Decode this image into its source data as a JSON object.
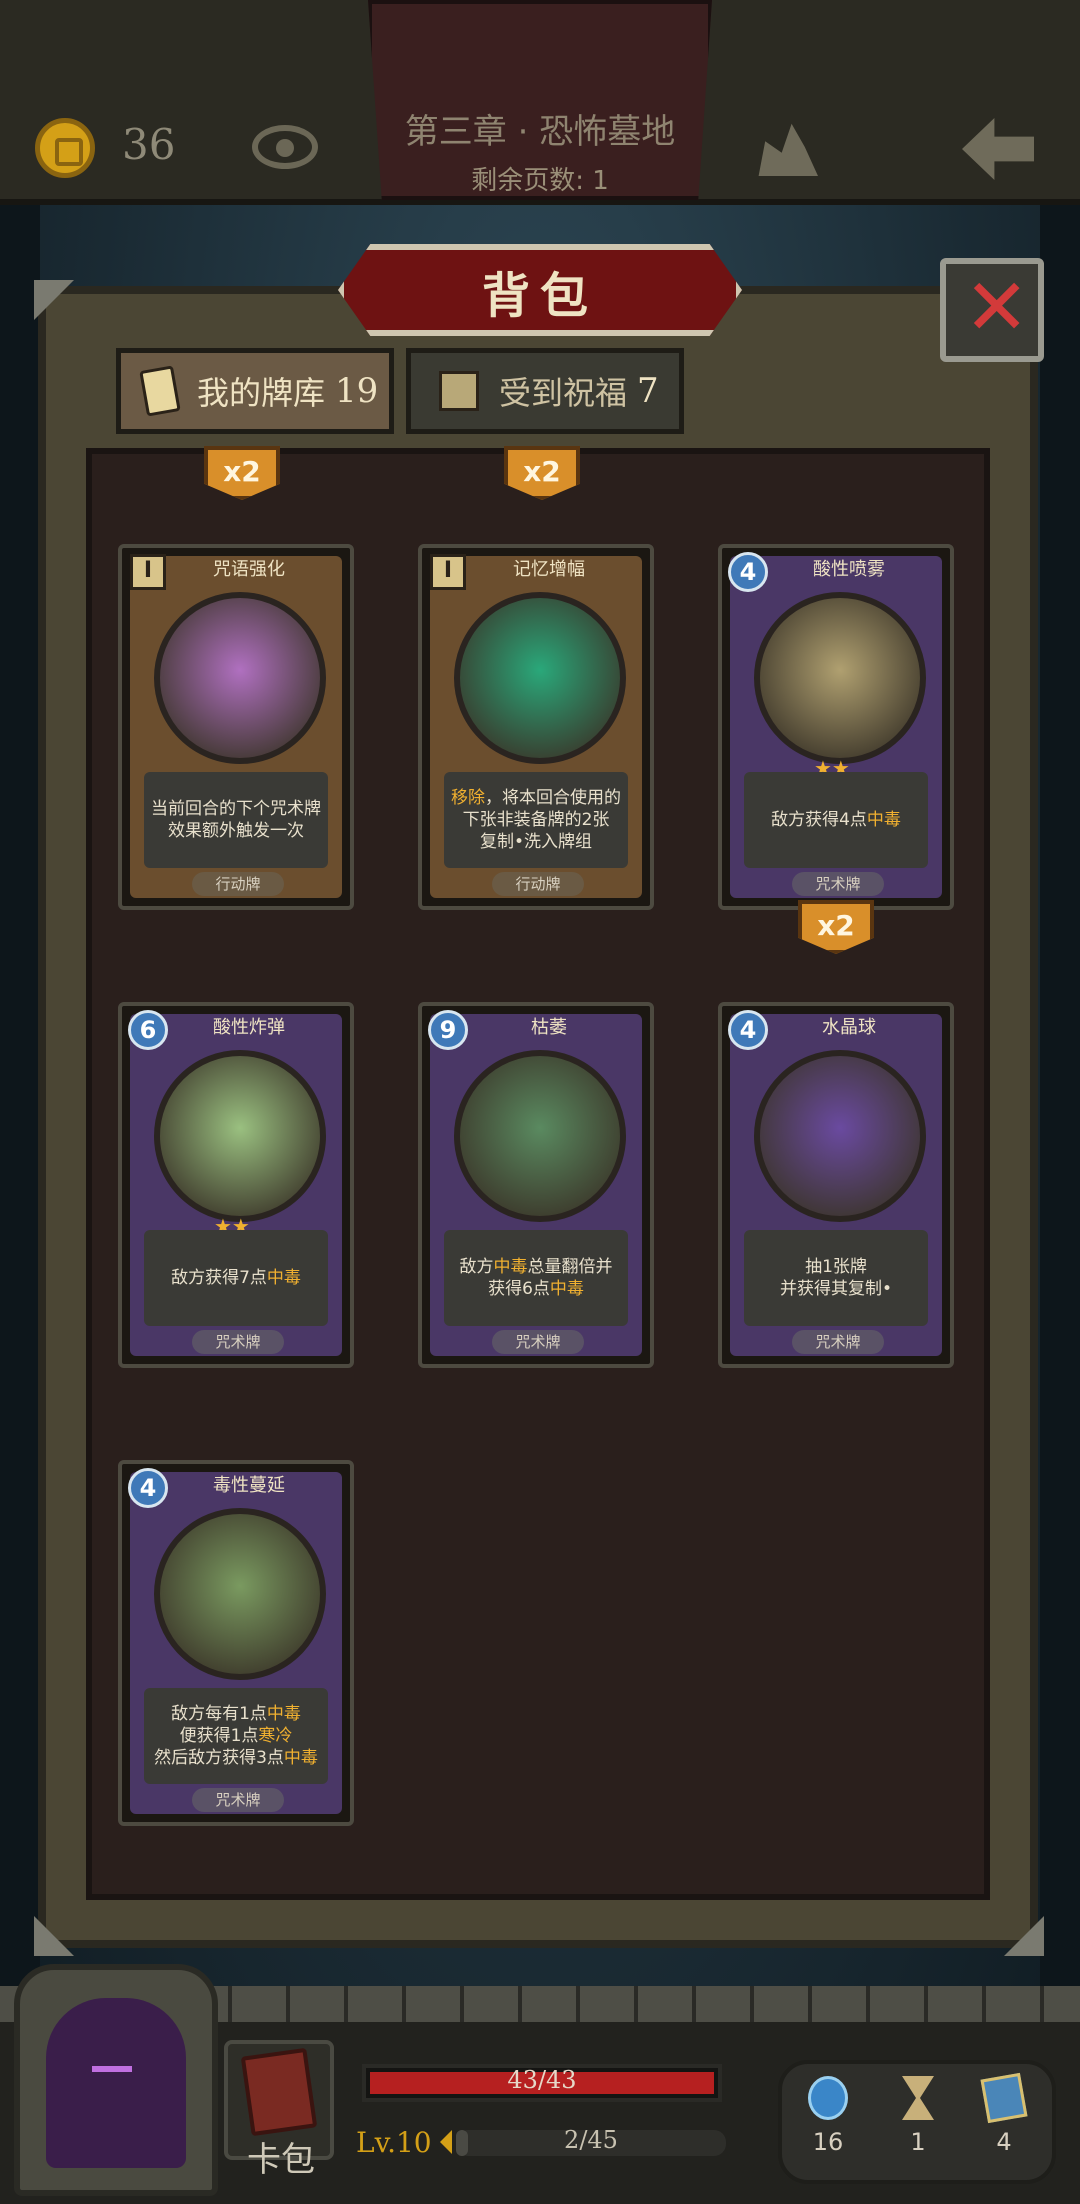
{
  "header": {
    "gold": "36",
    "chapter_title": "第三章 · 恐怖墓地",
    "pages_left": "剩余页数: 1"
  },
  "bag": {
    "title": "背包",
    "tabs": [
      {
        "label": "我的牌库",
        "count": "19",
        "active": true
      },
      {
        "label": "受到祝福",
        "count": "7",
        "active": false
      }
    ]
  },
  "cards": [
    {
      "name": "咒语强化",
      "cost": "I",
      "cost_type": "hourglass",
      "kind": "action",
      "type_label": "行动牌",
      "desc_lines": [
        "当前回合的下个咒术牌",
        "效果额外触发一次"
      ],
      "multiplier": "x2",
      "stars": 0
    },
    {
      "name": "记忆增幅",
      "cost": "I",
      "cost_type": "hourglass",
      "kind": "action",
      "type_label": "行动牌",
      "desc_lines": [
        "移除，将本回合使用的",
        "下张非装备牌的2张",
        "复制•洗入牌组"
      ],
      "multiplier": "x2",
      "stars": 0
    },
    {
      "name": "酸性喷雾",
      "cost": "4",
      "cost_type": "mana",
      "kind": "spell",
      "type_label": "咒术牌",
      "desc_lines": [
        "敌方获得4点中毒"
      ],
      "multiplier": "x2",
      "stars": 2
    },
    {
      "name": "酸性炸弹",
      "cost": "6",
      "cost_type": "mana",
      "kind": "spell",
      "type_label": "咒术牌",
      "desc_lines": [
        "敌方获得7点中毒"
      ],
      "multiplier": "",
      "stars": 2
    },
    {
      "name": "枯萎",
      "cost": "9",
      "cost_type": "mana",
      "kind": "spell",
      "type_label": "咒术牌",
      "desc_lines": [
        "敌方中毒总量翻倍并",
        "获得6点中毒"
      ],
      "multiplier": "",
      "stars": 0
    },
    {
      "name": "水晶球",
      "cost": "4",
      "cost_type": "mana",
      "kind": "spell",
      "type_label": "咒术牌",
      "desc_lines": [
        "抽1张牌",
        "并获得其复制•"
      ],
      "multiplier": "",
      "stars": 0
    },
    {
      "name": "毒性蔓延",
      "cost": "4",
      "cost_type": "mana",
      "kind": "spell",
      "type_label": "咒术牌",
      "desc_lines": [
        "敌方每有1点中毒",
        "便获得1点寒冷",
        "然后敌方获得3点中毒"
      ],
      "multiplier": "",
      "stars": 0
    }
  ],
  "hud": {
    "deck_label": "卡包",
    "hp_text": "43/43",
    "hp_fraction": 1.0,
    "level": "Lv.10",
    "xp_text": "2/45",
    "xp_fraction": 0.044,
    "resources": [
      {
        "icon": "orb-icon",
        "value": "16"
      },
      {
        "icon": "hourglass-icon",
        "value": "1"
      },
      {
        "icon": "cards-icon",
        "value": "4"
      }
    ]
  },
  "colors": {
    "accent_gold": "#d4a017",
    "hp_red": "#b62020",
    "poison_highlight": "#f0b030",
    "action_card": "#6b4e2e",
    "spell_card": "#4a3766"
  }
}
